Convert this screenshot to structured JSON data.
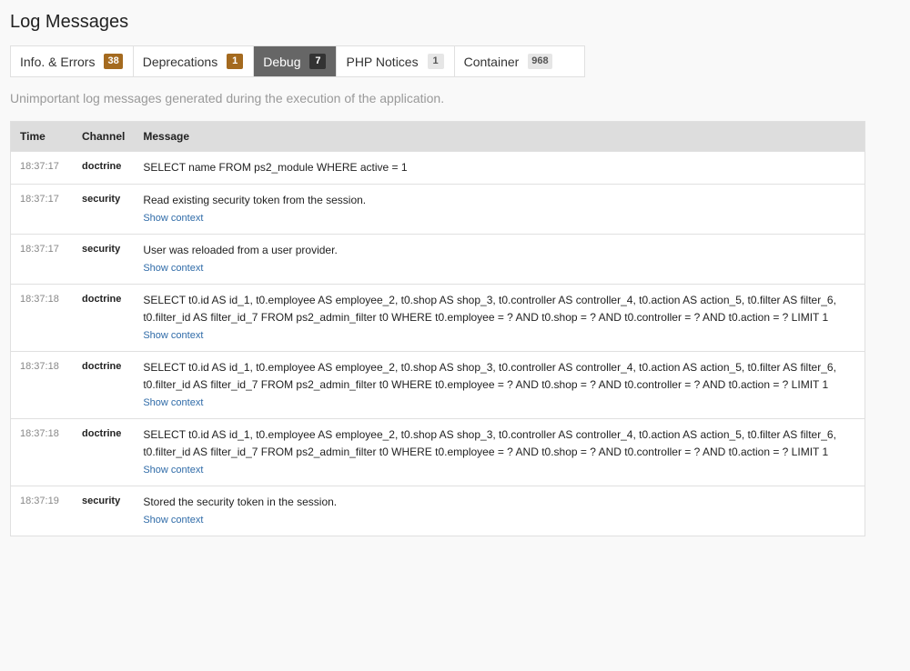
{
  "page": {
    "title": "Log Messages",
    "subtitle": "Unimportant log messages generated during the execution of the application."
  },
  "tabs": [
    {
      "label": "Info. & Errors",
      "count": "38",
      "badge_style": "warn",
      "active": false
    },
    {
      "label": "Deprecations",
      "count": "1",
      "badge_style": "warn",
      "active": false
    },
    {
      "label": "Debug",
      "count": "7",
      "badge_style": "dark",
      "active": true
    },
    {
      "label": "PHP Notices",
      "count": "1",
      "badge_style": "light",
      "active": false
    },
    {
      "label": "Container",
      "count": "968",
      "badge_style": "light",
      "active": false
    }
  ],
  "table": {
    "headers": {
      "time": "Time",
      "channel": "Channel",
      "message": "Message"
    },
    "context_link_label": "Show context",
    "rows": [
      {
        "time": "18:37:17",
        "channel": "doctrine",
        "message": "SELECT name FROM ps2_module WHERE active = 1",
        "has_context": false
      },
      {
        "time": "18:37:17",
        "channel": "security",
        "message": "Read existing security token from the session.",
        "has_context": true
      },
      {
        "time": "18:37:17",
        "channel": "security",
        "message": "User was reloaded from a user provider.",
        "has_context": true
      },
      {
        "time": "18:37:18",
        "channel": "doctrine",
        "message": "SELECT t0.id AS id_1, t0.employee AS employee_2, t0.shop AS shop_3, t0.controller AS controller_4, t0.action AS action_5, t0.filter AS filter_6, t0.filter_id AS filter_id_7 FROM ps2_admin_filter t0 WHERE t0.employee = ? AND t0.shop = ? AND t0.controller = ? AND t0.action = ? LIMIT 1",
        "has_context": true
      },
      {
        "time": "18:37:18",
        "channel": "doctrine",
        "message": "SELECT t0.id AS id_1, t0.employee AS employee_2, t0.shop AS shop_3, t0.controller AS controller_4, t0.action AS action_5, t0.filter AS filter_6, t0.filter_id AS filter_id_7 FROM ps2_admin_filter t0 WHERE t0.employee = ? AND t0.shop = ? AND t0.controller = ? AND t0.action = ? LIMIT 1",
        "has_context": true
      },
      {
        "time": "18:37:18",
        "channel": "doctrine",
        "message": "SELECT t0.id AS id_1, t0.employee AS employee_2, t0.shop AS shop_3, t0.controller AS controller_4, t0.action AS action_5, t0.filter AS filter_6, t0.filter_id AS filter_id_7 FROM ps2_admin_filter t0 WHERE t0.employee = ? AND t0.shop = ? AND t0.controller = ? AND t0.action = ? LIMIT 1",
        "has_context": true
      },
      {
        "time": "18:37:19",
        "channel": "security",
        "message": "Stored the security token in the session.",
        "has_context": true
      }
    ]
  }
}
